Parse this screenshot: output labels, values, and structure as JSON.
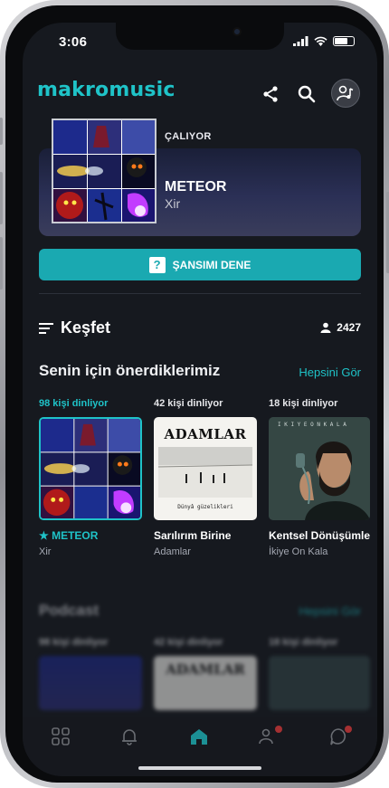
{
  "status_bar": {
    "time": "3:06"
  },
  "header": {
    "logo": "makromusic",
    "icons": [
      "share-icon",
      "search-icon",
      "user-music-icon"
    ]
  },
  "now_playing": {
    "label": "ÇALIYOR",
    "title": "METEOR",
    "artist": "Xir"
  },
  "luck_button": {
    "icon": "question-box-icon",
    "label": "ŞANSIMI DENE"
  },
  "discover": {
    "title": "Keşfet",
    "listener_count": "2427"
  },
  "recommended": {
    "title": "Senin için önerdiklerimiz",
    "see_all": "Hepsini Gör",
    "items": [
      {
        "count": "98 kişi dinliyor",
        "title": "★ METEOR",
        "subtitle": "Xir"
      },
      {
        "count": "42 kişi dinliyor",
        "title": "Sarılırım Birine",
        "subtitle": "Adamlar",
        "cover_text": "ADAMLAR",
        "cover_sub": "Dünyâ güzelikleri"
      },
      {
        "count": "18 kişi dinliyor",
        "title": "Kentsel Dönüşümle",
        "subtitle": "İkiye On Kala"
      }
    ]
  },
  "podcast": {
    "title": "Podcast",
    "see_all": "Hepsini Gör",
    "items": [
      {
        "count": "98 kişi dinliyor"
      },
      {
        "count": "42 kişi dinliyor",
        "cover_text": "ADAMLAR"
      },
      {
        "count": "18 kişi dinliyor"
      }
    ]
  },
  "tabbar": {
    "tabs": [
      "grid-icon",
      "bell-icon",
      "home-icon",
      "friends-icon",
      "chat-icon"
    ],
    "active": "home-icon",
    "accent": "#1fc3c8",
    "badge_color": "#e23a3a"
  }
}
